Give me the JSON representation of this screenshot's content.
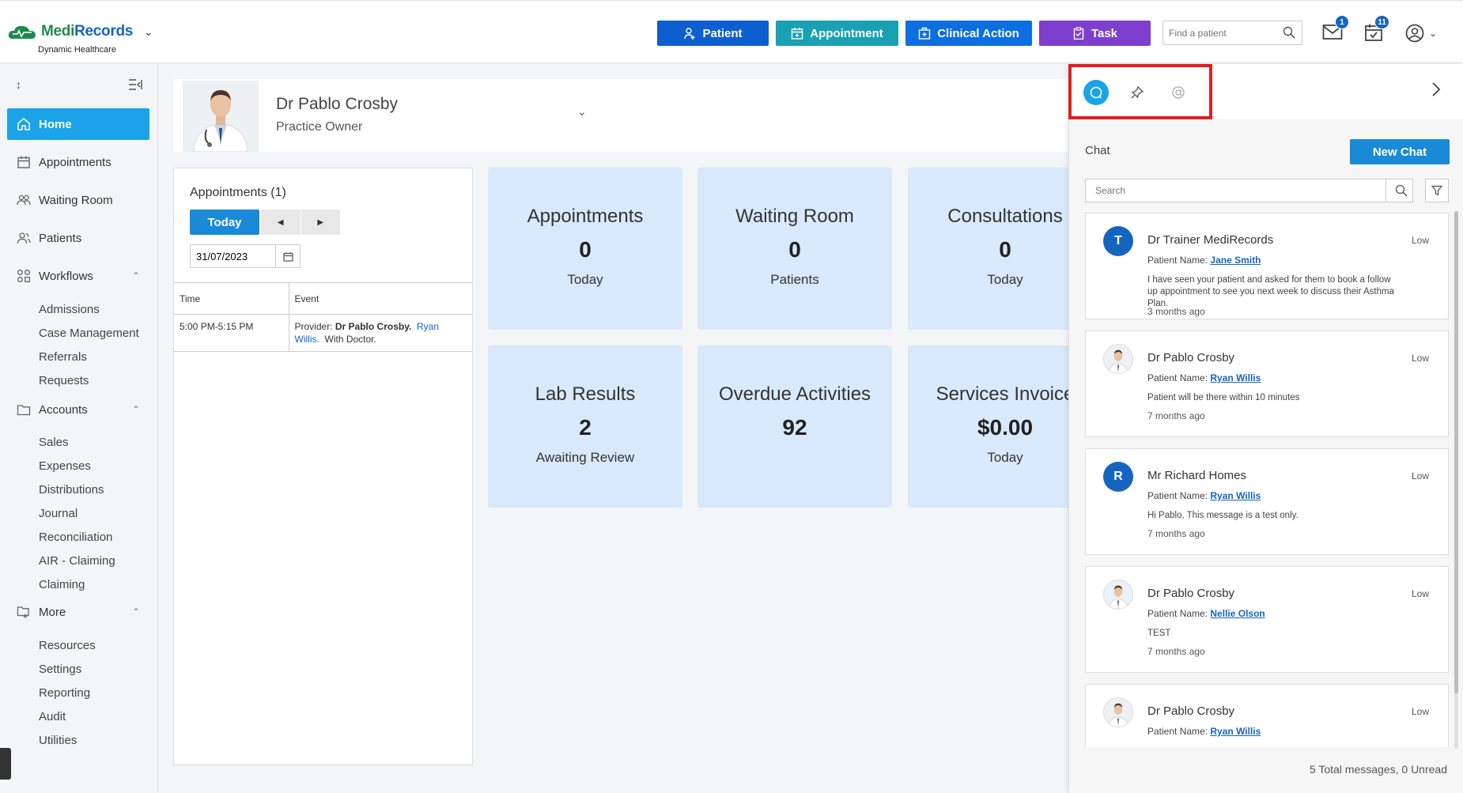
{
  "brand": {
    "name_part1": "Medi",
    "name_part2": "Records",
    "subtitle": "Dynamic Healthcare"
  },
  "header": {
    "buttons": [
      {
        "label": "Patient",
        "icon": "user-plus-icon",
        "color": "#0d5fcf"
      },
      {
        "label": "Appointment",
        "icon": "calendar-add-icon",
        "color": "#19a1b3"
      },
      {
        "label": "Clinical Action",
        "icon": "medical-kit-icon",
        "color": "#0d6fdf"
      },
      {
        "label": "Task",
        "icon": "clipboard-icon",
        "color": "#7e3fcf"
      }
    ],
    "search_placeholder": "Find a patient",
    "mail_badge": "1",
    "tasks_badge": "11"
  },
  "sidebar": {
    "items": [
      {
        "label": "Home",
        "icon": "home-icon",
        "active": true
      },
      {
        "label": "Appointments",
        "icon": "calendar-icon"
      },
      {
        "label": "Waiting Room",
        "icon": "group-icon"
      },
      {
        "label": "Patients",
        "icon": "users-icon"
      },
      {
        "label": "Workflows",
        "icon": "workflow-icon"
      },
      {
        "label": "Accounts",
        "icon": "folder-icon"
      },
      {
        "label": "More",
        "icon": "folder-tree-icon"
      }
    ],
    "workflows": [
      "Admissions",
      "Case Management",
      "Referrals",
      "Requests"
    ],
    "accounts": [
      "Sales",
      "Expenses",
      "Distributions",
      "Journal",
      "Reconciliation",
      "AIR - Claiming",
      "Claiming"
    ],
    "more": [
      "Resources",
      "Settings",
      "Reporting",
      "Audit",
      "Utilities"
    ]
  },
  "profile": {
    "name": "Dr Pablo Crosby",
    "role": "Practice Owner"
  },
  "appointments": {
    "title": "Appointments (1)",
    "today_label": "Today",
    "date": "31/07/2023",
    "columns": [
      "Time",
      "Event"
    ],
    "rows": [
      {
        "time": "5:00 PM-5:15 PM",
        "provider_prefix": "Provider:",
        "provider": "Dr Pablo Crosby.",
        "patient": "Ryan Willis.",
        "suffix": "With Doctor."
      }
    ]
  },
  "cards": [
    {
      "title": "Appointments",
      "value": "0",
      "sub": "Today"
    },
    {
      "title": "Waiting Room",
      "value": "0",
      "sub": "Patients"
    },
    {
      "title": "Consultations",
      "value": "0",
      "sub": "Today"
    },
    {
      "title": "Lab Results",
      "value": "2",
      "sub": "Awaiting Review"
    },
    {
      "title": "Overdue Activities",
      "value": "92",
      "sub": ""
    },
    {
      "title": "Services Invoice",
      "value": "$0.00",
      "sub": "Today"
    }
  ],
  "chat": {
    "heading": "Chat",
    "new_chat_label": "New Chat",
    "search_placeholder": "Search",
    "patient_name_label": "Patient Name:",
    "messages": [
      {
        "sender": "Dr Trainer MediRecords",
        "avatar_letter": "T",
        "photo": false,
        "priority": "Low",
        "patient": "Jane Smith",
        "text": "I have seen your patient and asked for them to book a follow up appointment to see you next week to discuss their Asthma Plan.",
        "time": "3 months ago"
      },
      {
        "sender": "Dr Pablo Crosby",
        "avatar_letter": "",
        "photo": true,
        "priority": "Low",
        "patient": "Ryan Willis",
        "text": "Patient will be there within 10 minutes",
        "time": "7 months ago"
      },
      {
        "sender": "Mr Richard Homes",
        "avatar_letter": "R",
        "photo": false,
        "priority": "Low",
        "patient": "Ryan Willis",
        "text": "Hi Pablo, This message is a test only.",
        "time": "7 months ago"
      },
      {
        "sender": "Dr Pablo Crosby",
        "avatar_letter": "",
        "photo": true,
        "priority": "Low",
        "patient": "Nellie Olson",
        "text": "TEST",
        "time": "7 months ago"
      },
      {
        "sender": "Dr Pablo Crosby",
        "avatar_letter": "",
        "photo": true,
        "priority": "Low",
        "patient": "Ryan Willis",
        "text": "",
        "time": ""
      }
    ],
    "footer": "5 Total messages, 0 Unread"
  }
}
